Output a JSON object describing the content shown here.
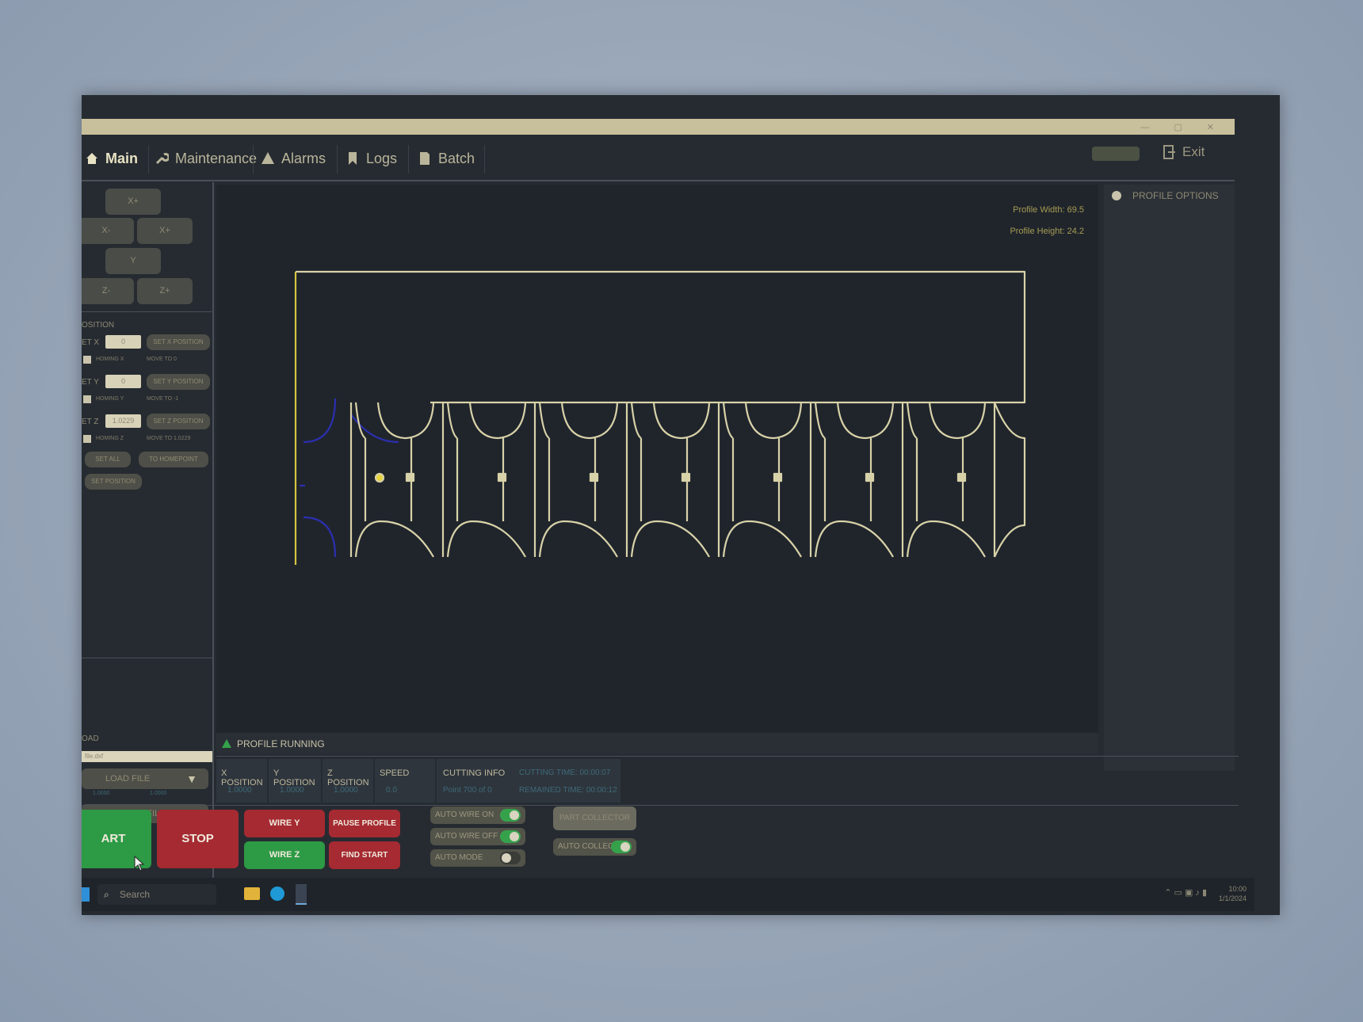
{
  "tabs": [
    {
      "label": "Main",
      "icon": "home-icon"
    },
    {
      "label": "Maintenance",
      "icon": "wrench-icon"
    },
    {
      "label": "Alarms",
      "icon": "warning-icon"
    },
    {
      "label": "Logs",
      "icon": "bookmark-icon"
    },
    {
      "label": "Batch",
      "icon": "document-icon"
    }
  ],
  "header": {
    "exit_label": "Exit",
    "badge_top": "",
    "badge_sub": ""
  },
  "jog": {
    "up": "X+",
    "left": "X-",
    "right": "X+",
    "down": "Y",
    "z_minus": "Z-",
    "z_plus": "Z+"
  },
  "position_section": {
    "title": "OSITION",
    "rows": [
      {
        "label": "ET X",
        "value": "0",
        "set_btn": "SET X POSITION",
        "check_label": "HOMING X",
        "move_label": "MOVE TO 0"
      },
      {
        "label": "ET Y",
        "value": "0",
        "set_btn": "SET Y POSITION",
        "check_label": "HOMING Y",
        "move_label": "MOVE TO -1"
      },
      {
        "label": "ET Z",
        "value": "1.0229",
        "set_btn": "SET Z POSITION",
        "check_label": "HOMING Z",
        "move_label": "MOVE TO 1.0229"
      }
    ],
    "set_all": "SET ALL",
    "to_home": "TO HOMEPOINT",
    "set_position": "SET POSITION"
  },
  "load_section": {
    "title": "OAD",
    "file_value": "file.dxf",
    "load_button": "LOAD FILE",
    "coord_a": "1.0000",
    "coord_b": "1.0000",
    "edit_button": "EDIT FILE"
  },
  "canvas": {
    "profile_width": "Profile Width: 69.5",
    "profile_height": "Profile Height: 24.2"
  },
  "profile_options": {
    "title": "PROFILE OPTIONS"
  },
  "status": {
    "text": "PROFILE RUNNING"
  },
  "readouts": [
    {
      "header": "X POSITION",
      "value": "1.0000"
    },
    {
      "header": "Y POSITION",
      "value": "1.0000"
    },
    {
      "header": "Z POSITION",
      "value": "1.0000"
    },
    {
      "header": "SPEED",
      "value": "0.0"
    },
    {
      "header": "CUTTING INFO",
      "value": "Point 700 of 0",
      "extra_top": "CUTTING TIME: 00:00:07",
      "extra_bottom": "REMAINED TIME: 00:00:12"
    }
  ],
  "controls": {
    "start": "ART PROFILE",
    "stop": "STOP PROFILE",
    "wire_y": "WIRE Y",
    "wire_z": "WIRE Z",
    "pause": "PAUSE PROFILE",
    "find_start": "FIND START",
    "auto_wire_on": "AUTO WIRE ON",
    "auto_wire_off": "AUTO WIRE OFF",
    "auto_mode": "AUTO MODE",
    "part_collector": "PART COLLECTOR",
    "auto_collector": "AUTO COLLECTO"
  },
  "taskbar": {
    "search": "Search",
    "clock_time": "10:00",
    "clock_date": "1/1/2024"
  },
  "colors": {
    "path_line": "#d8d2a8",
    "entry_line": "#2b2fb0",
    "start_green": "#2d9a45",
    "stop_red": "#a52a32"
  }
}
